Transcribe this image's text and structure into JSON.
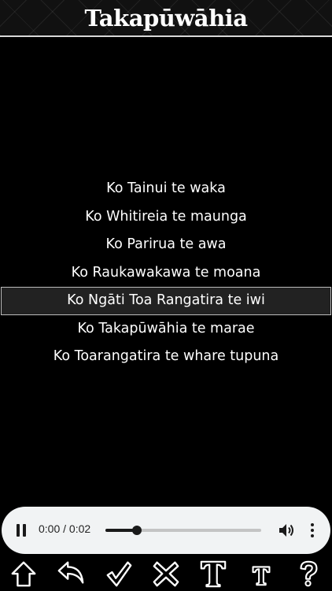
{
  "header": {
    "title": "Takapūwāhia"
  },
  "lyrics": [
    {
      "text": "Ko Tainui te waka",
      "active": false
    },
    {
      "text": "Ko Whitireia te maunga",
      "active": false
    },
    {
      "text": "Ko Parirua te awa",
      "active": false
    },
    {
      "text": "Ko Raukawakawa te moana",
      "active": false
    },
    {
      "text": "Ko Ngāti Toa Rangatira te iwi",
      "active": true
    },
    {
      "text": "Ko Takapūwāhia te marae",
      "active": false
    },
    {
      "text": "Ko Toarangatira te whare tupuna",
      "active": false
    }
  ],
  "player": {
    "state": "playing",
    "pause_icon": "pause-icon",
    "time_display": "0:00 / 0:02",
    "progress_fraction": 0.2,
    "volume_icon": "volume-icon",
    "more_icon": "more-vertical-icon"
  },
  "toolbar": {
    "icons": [
      "home-icon",
      "back-icon",
      "check-icon",
      "cross-icon",
      "text-large-icon",
      "text-small-icon",
      "help-icon"
    ]
  },
  "colors": {
    "background": "#000000",
    "text": "#ffffff",
    "active_row_bg": "#222222",
    "active_row_border": "#bdbdbd",
    "player_bg": "#f1f3f4"
  }
}
